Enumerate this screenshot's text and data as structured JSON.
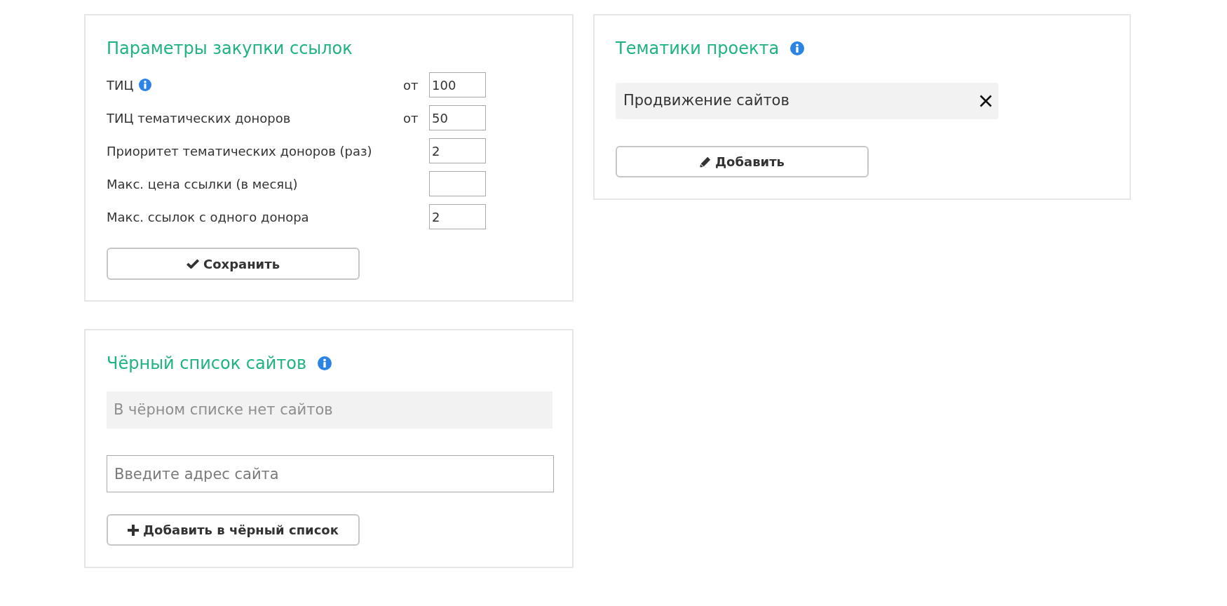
{
  "purchase_params": {
    "title": "Параметры закупки ссылок",
    "info": false,
    "rows": [
      {
        "label": "ТИЦ",
        "info": true,
        "prefix": "от",
        "value": "100"
      },
      {
        "label": "ТИЦ тематических доноров",
        "info": false,
        "prefix": "от",
        "value": "50"
      },
      {
        "label": "Приоритет тематических доноров (раз)",
        "info": false,
        "value": "2"
      },
      {
        "label": "Макс. цена ссылки (в месяц)",
        "info": false
      },
      {
        "label": "Макс. ссылок с одного донора",
        "info": false,
        "value": "2"
      }
    ],
    "save_button": "Сохранить"
  },
  "project_topics": {
    "title": "Тематики проекта",
    "info": true,
    "topics": [
      {
        "label": "Продвижение сайтов"
      }
    ],
    "add_button": "Добавить"
  },
  "blacklist": {
    "title": "Чёрный список сайтов",
    "info": true,
    "empty_message": "В чёрном списке нет сайтов",
    "input": {
      "placeholder": "Введите адрес сайта"
    },
    "add_button": "Добавить в чёрный список"
  }
}
